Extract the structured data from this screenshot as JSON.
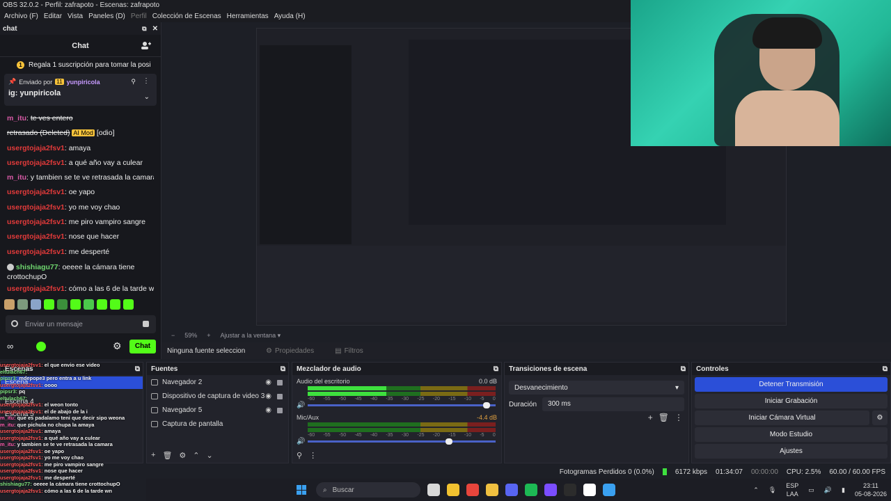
{
  "window": {
    "title": "OBS 32.0.2 - Perfil: zafrapoto - Escenas: zafrapoto"
  },
  "menu": [
    "Archivo (F)",
    "Editar",
    "Vista",
    "Paneles (D)",
    "Perfil",
    "Colección de Escenas",
    "Herramientas",
    "Ayuda (H)"
  ],
  "chat": {
    "dock_title": "chat",
    "header": "Chat",
    "gift": "Regala 1 suscripción para tomar la posi",
    "pinned_by": "Enviado por",
    "pinned_badge": "11",
    "pinned_user": "yunpiricola",
    "pinned_msg": "ig: yunpiricola",
    "messages": [
      {
        "user": "m_itu",
        "color": "pink",
        "text": "te ves entero",
        "strike": true
      },
      {
        "user": "",
        "color": "",
        "text": "retrasado (Deleted)",
        "badge": "AI Mod",
        "suffix": "[odio]"
      },
      {
        "user": "usergtojaja2fsv1",
        "color": "red",
        "text": "amaya"
      },
      {
        "user": "usergtojaja2fsv1",
        "color": "red",
        "text": "a qué año vay a culear"
      },
      {
        "user": "m_itu",
        "color": "pink",
        "text": "y tambien se te ve retrasada la camara"
      },
      {
        "user": "usergtojaja2fsv1",
        "color": "red",
        "text": "oe yapo"
      },
      {
        "user": "usergtojaja2fsv1",
        "color": "red",
        "text": "yo me voy chao"
      },
      {
        "user": "usergtojaja2fsv1",
        "color": "red",
        "text": "me piro vampiro sangre"
      },
      {
        "user": "usergtojaja2fsv1",
        "color": "red",
        "text": "nose que hacer"
      },
      {
        "user": "usergtojaja2fsv1",
        "color": "red",
        "text": "me desperté"
      },
      {
        "user": "shishiagu77",
        "color": "green",
        "text": "oeeee la cámara tiene"
      },
      {
        "user": "",
        "color": "",
        "text": "crottochupO"
      },
      {
        "user": "usergtojaja2fsv1",
        "color": "red",
        "text": "cómo a las 6 de la tarde wn"
      }
    ],
    "input_placeholder": "Enviar un mensaje",
    "send_label": "Chat",
    "emote_colors": [
      "#c9a06a",
      "#7d9a7d",
      "#8aa4c8",
      "#53fc18",
      "#3b8f3b",
      "#53fc18",
      "#4bc84b",
      "#53fc18",
      "#53fc18",
      "#53fc18"
    ]
  },
  "zoom": {
    "minus": "−",
    "value": "59%",
    "plus": "+",
    "fit": "Ajustar a la ventana"
  },
  "source_bar": {
    "label": "Ninguna fuente seleccionad",
    "properties": "Propiedades",
    "filters": "Filtros"
  },
  "docks": {
    "scenes": "Escenas",
    "sources": "Fuentes",
    "mixer": "Mezclador de audio",
    "transitions": "Transiciones de escena",
    "controls": "Controles"
  },
  "scenes": [
    "Escena",
    "Escena 4",
    "Escena 5"
  ],
  "sources": [
    "Navegador 2",
    "Dispositivo de captura de video 3",
    "Navegador 5",
    "Captura de pantalla"
  ],
  "mixer": [
    {
      "name": "Audio del escritorio",
      "db": "0.0 dB",
      "level": 0.42,
      "slider": 0.97
    },
    {
      "name": "Mic/Aux",
      "db": "-4.4 dB",
      "level": 0.0,
      "slider": 0.77
    }
  ],
  "mixer_scale": [
    "-60",
    "-55",
    "-50",
    "-45",
    "-40",
    "-35",
    "-30",
    "-25",
    "-20",
    "-15",
    "-10",
    "-5",
    "0"
  ],
  "transitions": {
    "type": "Desvanecimiento",
    "duration_label": "Duración",
    "duration_value": "300 ms"
  },
  "controls": [
    "Detener Transmisión",
    "Iniciar Grabación",
    "Iniciar Cámara Virtual",
    "Modo Estudio",
    "Ajustes"
  ],
  "status": {
    "dropped": "Fotogramas Perdidos 0 (0.0%)",
    "kbps": "6172 kbps",
    "stream_time": "01:34:07",
    "rec_time": "00:00:00",
    "cpu": "CPU: 2.5%",
    "fps": "60.00 / 60.00 FPS"
  },
  "overlay_chat": [
    "usergtojaja2fsv1: el que envio ese video",
    "eltulach67: ",
    "pipsr3: mdepope3 pero entra a u link",
    "usergtojaja2fsv1: oooo",
    "pipsr3: pq",
    "eltulach67: ",
    "usergtojaja2fsv1: el weon tonto",
    "usergtojaja2fsv1: el de abajo de la i",
    "m_itu: que es padalamo teni que decir sipo weona",
    "m_itu: que pichula no chupa la amaya",
    "usergtojaja2fsv1: amaya",
    "usergtojaja2fsv1: a qué año vay a culear",
    "m_itu: y tambien se te ve retrasada la camara",
    "usergtojaja2fsv1: oe yapo",
    "usergtojaja2fsv1: yo me voy chao",
    "usergtojaja2fsv1: me piro vampiro sangre",
    "usergtojaja2fsv1: nose que hacer",
    "usergtojaja2fsv1: me desperté",
    "shishiagu77: oeeee la cámara tiene crottochupO",
    "usergtojaja2fsv1: cómo a las 6 de la tarde wn"
  ],
  "taskbar": {
    "search": "Buscar",
    "lang": "ESP",
    "lang2": "LAA",
    "time": "23:11",
    "date": "05-08-2026",
    "apps": [
      "#d8d8d8",
      "#f2c230",
      "#e8453c",
      "#f0c040",
      "#5865f2",
      "#1db954",
      "#7b4dff",
      "#2c2c2c",
      "#ffffff",
      "#3aa0f0"
    ]
  }
}
